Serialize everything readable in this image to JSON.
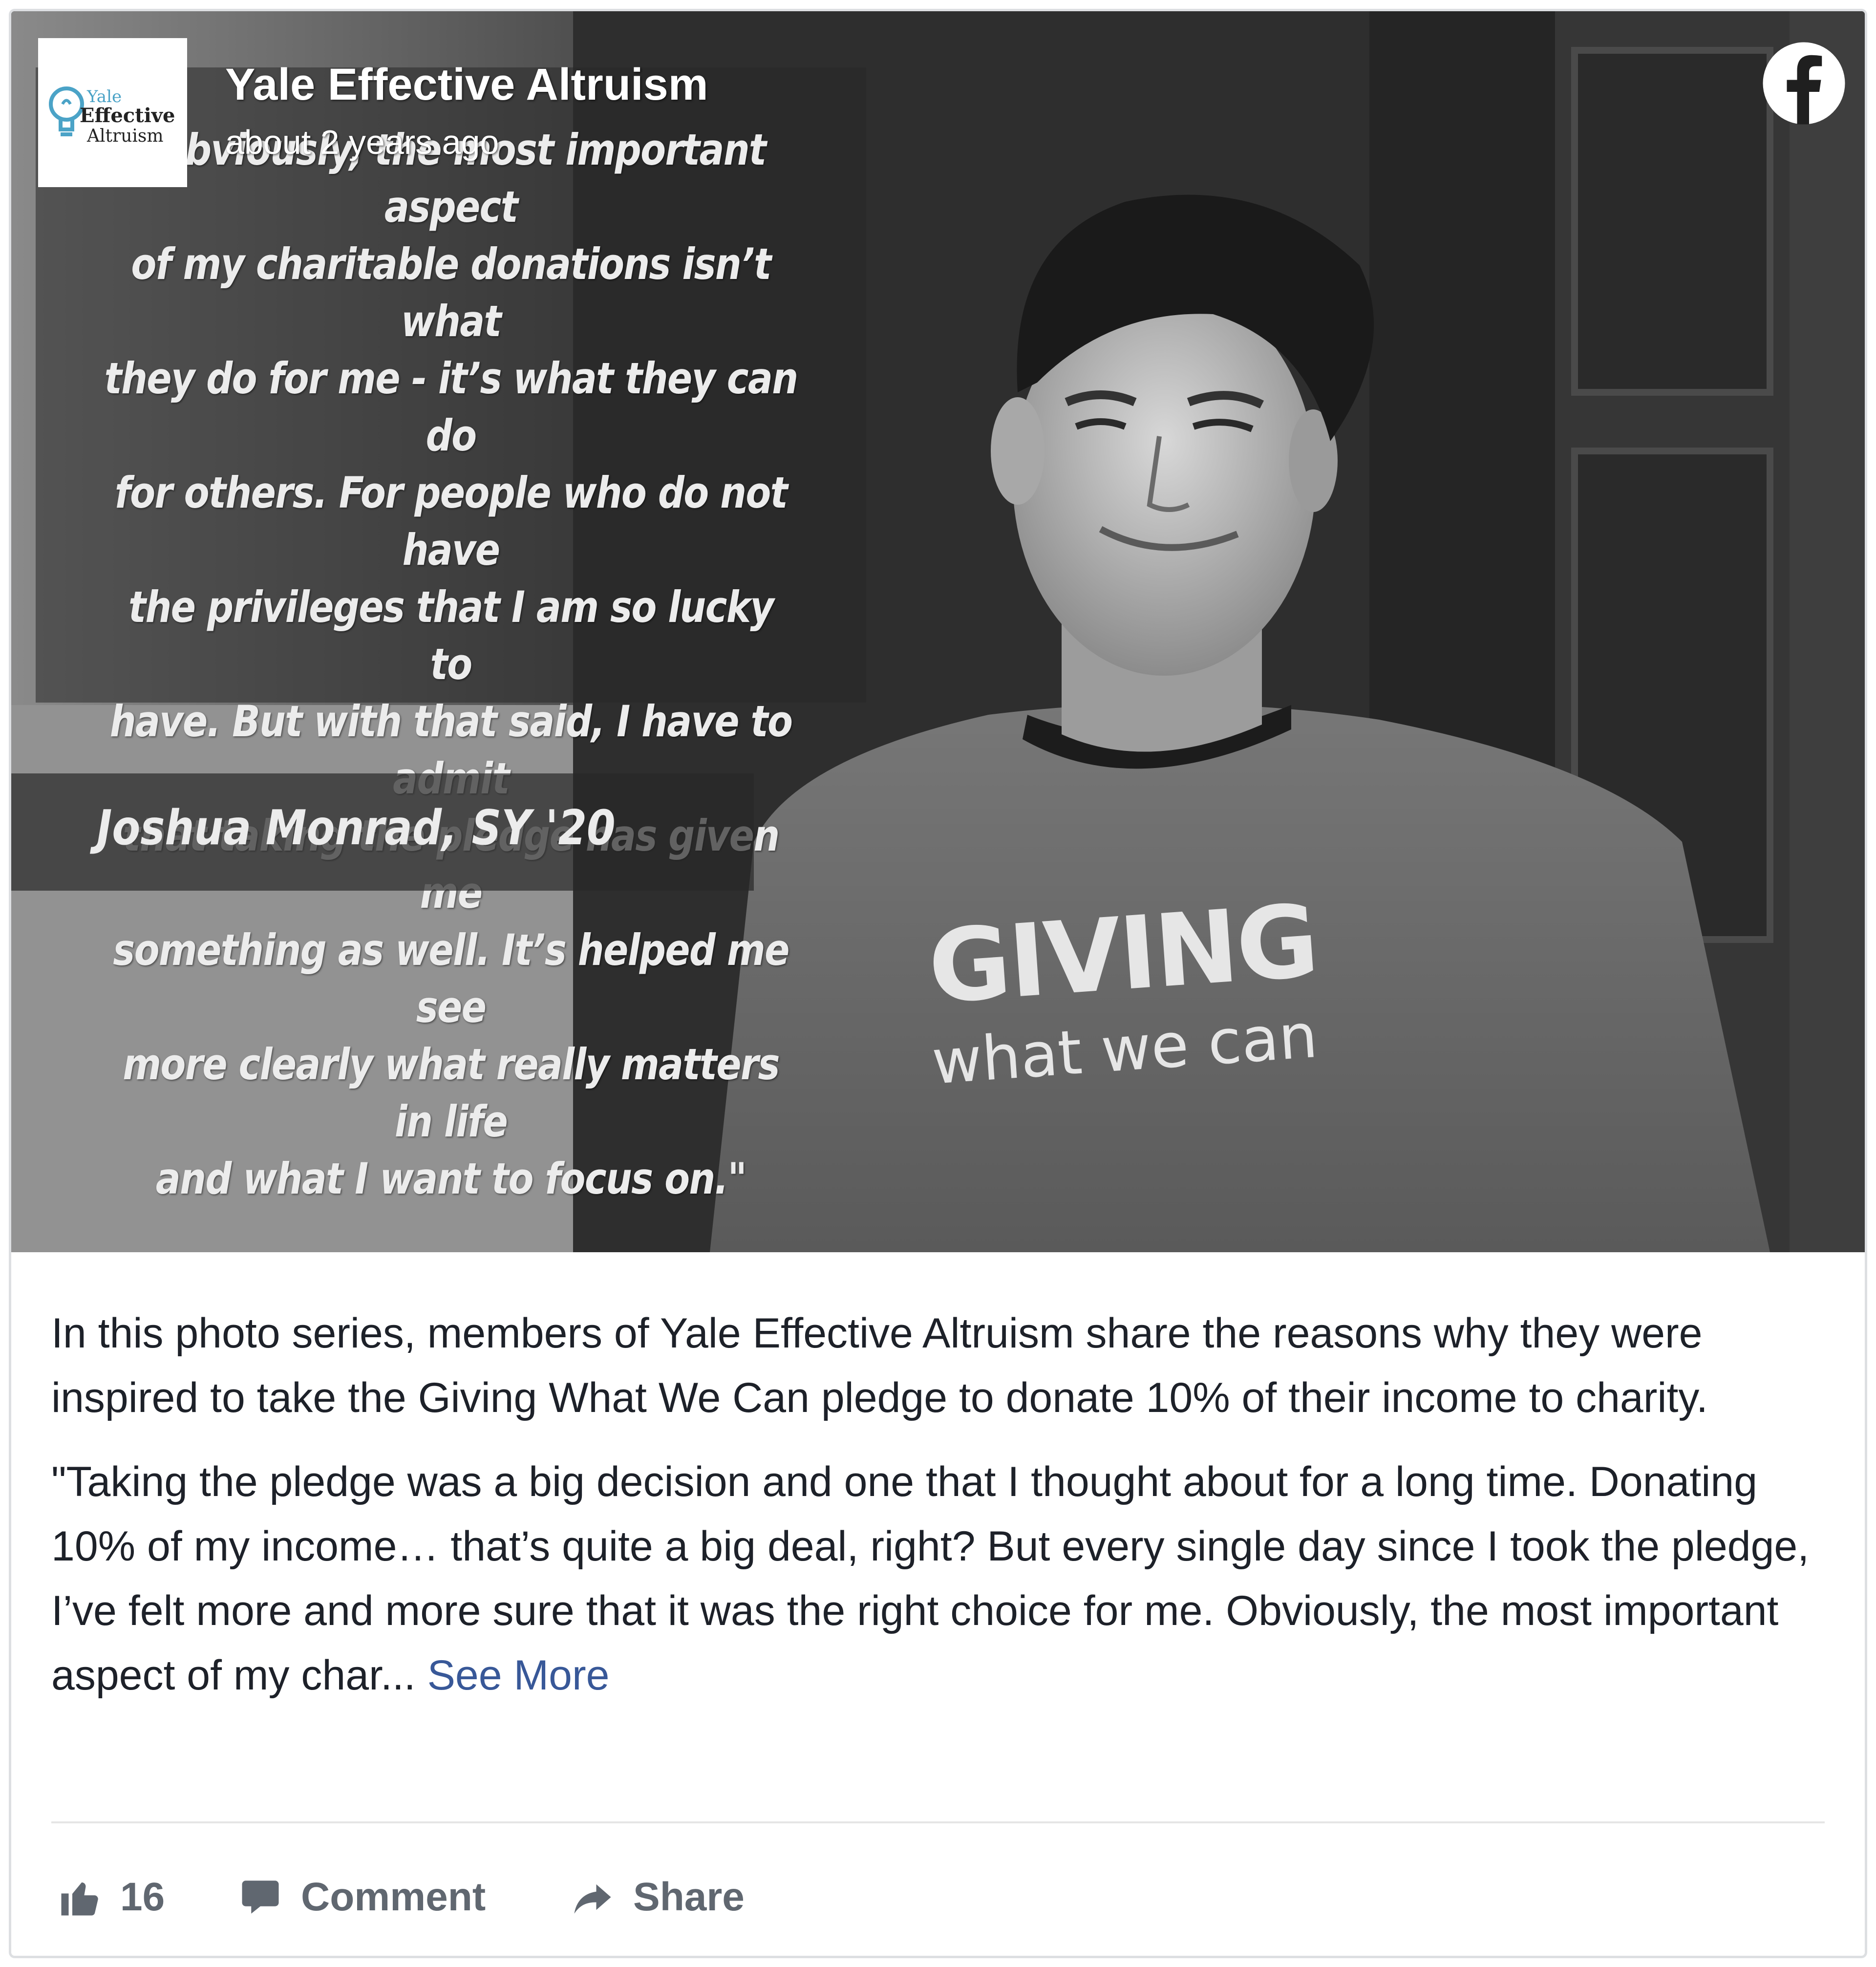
{
  "post": {
    "page_name": "Yale Effective Altruism",
    "timestamp": "about 2 years ago",
    "logo": {
      "line1": "Yale",
      "line2": "Effective",
      "line3": "Altruism"
    },
    "image": {
      "quote_lines": [
        "\"Obviously, the most important aspect",
        "of my charitable donations isn’t what",
        "they do for me - it’s what they can do",
        "for others. For people who do not have",
        "the privileges that I am so lucky to",
        "have. But with that said, I have to admit",
        "that taking the pledge has given me",
        "something as well. It’s helped me see",
        "more clearly what really matters in life",
        "and what I want to focus on.\""
      ],
      "attribution": "Joshua Monrad, SY '20",
      "shirt_line1": "GIVING",
      "shirt_line2": "what we can"
    },
    "body": {
      "paragraph1": "In this photo series, members of Yale Effective Altruism share the reasons why they were inspired to take the Giving What We Can pledge to donate 10% of their income to charity.",
      "paragraph2": "\"Taking the pledge was a big decision and one that I thought about for a long time. Donating 10% of my income… that’s quite a big deal, right? But every single day since I took the pledge, I’ve felt more and more sure that it was the right choice for me. Obviously, the most important aspect of my char... ",
      "see_more": "See More"
    },
    "actions": {
      "like_count": "16",
      "comment_label": "Comment",
      "share_label": "Share"
    },
    "icons": {
      "platform": "facebook-icon",
      "like": "thumbs-up-icon",
      "comment": "speech-bubble-icon",
      "share": "share-arrow-icon",
      "logo": "lightbulb-icon"
    },
    "colors": {
      "link": "#385898",
      "action_text": "#606770",
      "body_text": "#1d2129",
      "border": "#dddfe2"
    }
  }
}
